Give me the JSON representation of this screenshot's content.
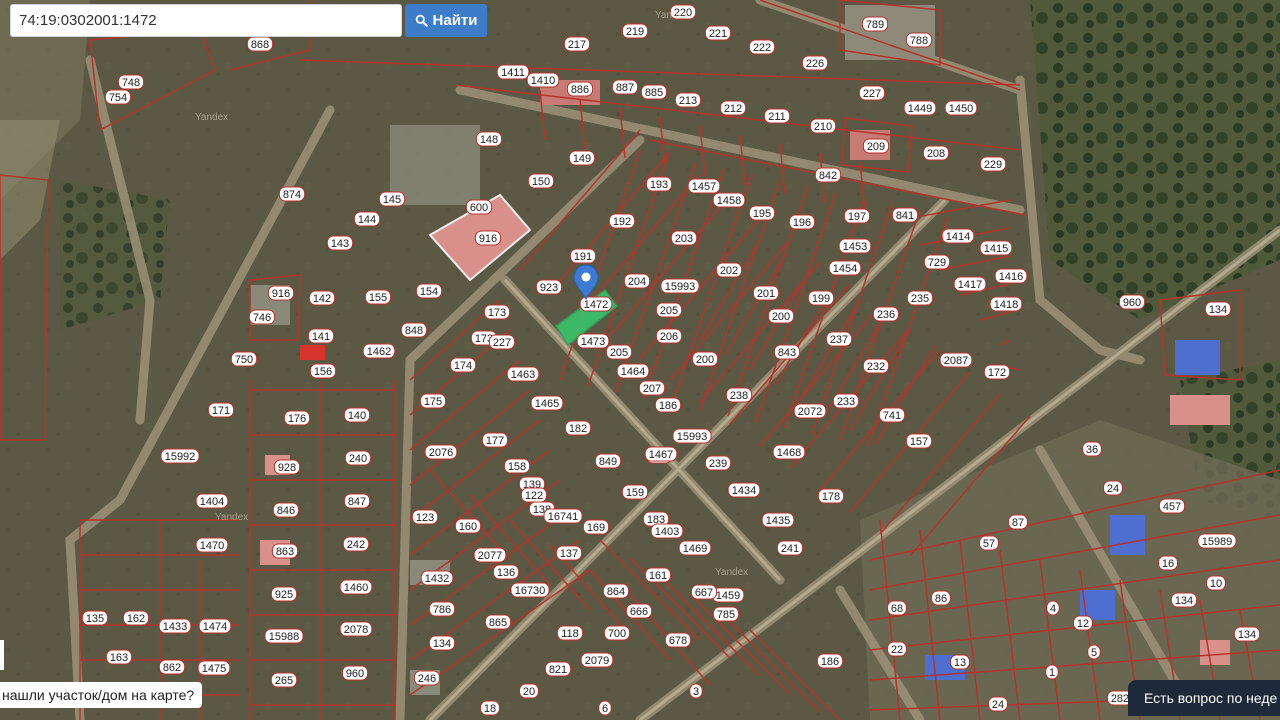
{
  "search": {
    "value": "74:19:0302001:1472",
    "button_label": "Найти"
  },
  "hint_text": "нашли участок/дом на карте?",
  "chat_text": "Есть вопрос по неде",
  "watermark": "Yandex",
  "selected_parcel": "1472",
  "colors": {
    "parcel_border": "#b5332d",
    "selected_fill": "#39c46a",
    "marker": "#3b7bd4",
    "button": "#3d7cc9"
  },
  "parcel_labels": [
    "868",
    "748",
    "754",
    "217",
    "219",
    "220",
    "221",
    "222",
    "226",
    "789",
    "788",
    "1411",
    "1410",
    "886",
    "887",
    "885",
    "213",
    "212",
    "211",
    "210",
    "227",
    "1449",
    "1450",
    "148",
    "149",
    "150",
    "193",
    "1457",
    "1458",
    "195",
    "196",
    "197",
    "841",
    "842",
    "209",
    "208",
    "229",
    "874",
    "144",
    "145",
    "600",
    "916",
    "192",
    "203",
    "191",
    "202",
    "1453",
    "1454",
    "1414",
    "1415",
    "729",
    "1416",
    "1417",
    "1418",
    "143",
    "155",
    "154",
    "923",
    "173",
    "1472",
    "204",
    "15993",
    "201",
    "199",
    "235",
    "236",
    "960",
    "142",
    "746",
    "916",
    "848",
    "173",
    "227",
    "1473",
    "205",
    "200",
    "236",
    "134",
    "141",
    "156",
    "1462",
    "205",
    "206",
    "200",
    "843",
    "237",
    "232",
    "2087",
    "172",
    "174",
    "1463",
    "1464",
    "207",
    "238",
    "233",
    "741",
    "750",
    "171",
    "175",
    "1465",
    "186",
    "15993",
    "2072",
    "157",
    "140",
    "176",
    "182",
    "177",
    "849",
    "239",
    "742",
    "158",
    "170",
    "1468",
    "15992",
    "240",
    "2076",
    "139",
    "1467",
    "1434",
    "178",
    "928",
    "122",
    "138",
    "159",
    "1435",
    "1404",
    "846",
    "847",
    "16741",
    "169",
    "183",
    "1403",
    "241",
    "123",
    "160",
    "137",
    "1469",
    "1470",
    "242",
    "863",
    "2077",
    "136",
    "161",
    "1432",
    "1459",
    "925",
    "1460",
    "16730",
    "864",
    "667",
    "666",
    "785",
    "786",
    "135",
    "162",
    "1433",
    "1474",
    "15988",
    "2078",
    "865",
    "118",
    "700",
    "678",
    "134",
    "163",
    "862",
    "1475",
    "265",
    "960",
    "246",
    "2079",
    "821",
    "3",
    "20",
    "6",
    "18",
    "36",
    "24",
    "457",
    "87",
    "57",
    "16",
    "10",
    "68",
    "86",
    "4",
    "12",
    "5",
    "22",
    "13",
    "1",
    "186",
    "24",
    "282",
    "134",
    "134",
    "15989"
  ],
  "marker_icon": "map-pin-icon",
  "search_icon": "magnifier-icon"
}
